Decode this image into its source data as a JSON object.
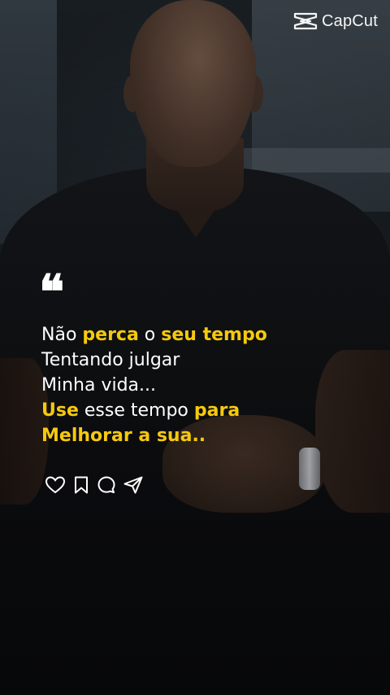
{
  "watermark": {
    "brand": "CapCut",
    "icon": "capcut-logo-icon"
  },
  "quote": {
    "mark": "❝",
    "lines": [
      [
        {
          "text": "Não ",
          "hl": false
        },
        {
          "text": "perca",
          "hl": true
        },
        {
          "text": " o ",
          "hl": false
        },
        {
          "text": "seu tempo",
          "hl": true
        }
      ],
      [
        {
          "text": "Tentando julgar",
          "hl": false
        }
      ],
      [
        {
          "text": "Minha vida...",
          "hl": false
        }
      ],
      [
        {
          "text": "Use",
          "hl": true
        },
        {
          "text": " esse tempo ",
          "hl": false
        },
        {
          "text": "para",
          "hl": true
        }
      ],
      [
        {
          "text": "Melhorar a sua..",
          "hl": true
        }
      ]
    ]
  },
  "actions": {
    "icons": [
      "heart-icon",
      "bookmark-icon",
      "comment-icon",
      "send-icon"
    ]
  },
  "colors": {
    "highlight": "#f6c90e",
    "text": "#ffffff"
  }
}
